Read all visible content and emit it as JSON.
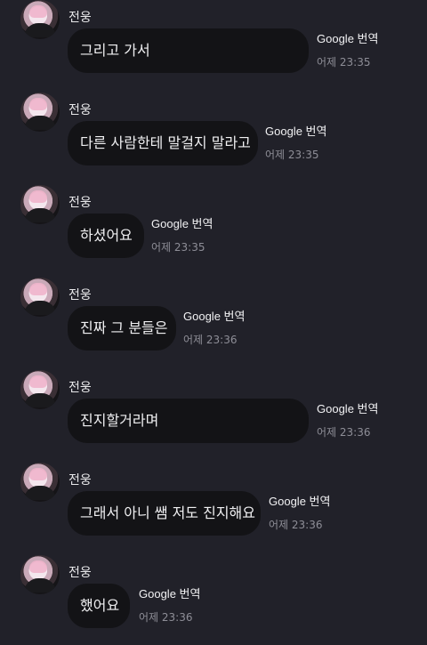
{
  "messages": [
    {
      "sender": "전웅",
      "text": "그리고 가서",
      "translate_label": "Google 번역",
      "timestamp": "어제 23:35"
    },
    {
      "sender": "전웅",
      "text": "다른 사람한테 말걸지 말라고",
      "translate_label": "Google 번역",
      "timestamp": "어제 23:35"
    },
    {
      "sender": "전웅",
      "text": "하셨어요",
      "translate_label": "Google 번역",
      "timestamp": "어제 23:35"
    },
    {
      "sender": "전웅",
      "text": "진짜 그 분들은",
      "translate_label": "Google 번역",
      "timestamp": "어제 23:36"
    },
    {
      "sender": "전웅",
      "text": "진지할거라며",
      "translate_label": "Google 번역",
      "timestamp": "어제 23:36"
    },
    {
      "sender": "전웅",
      "text": "그래서 아니 쌤 저도 진지해요",
      "translate_label": "Google 번역",
      "timestamp": "어제 23:36"
    },
    {
      "sender": "전웅",
      "text": "했어요",
      "translate_label": "Google 번역",
      "timestamp": "어제 23:36"
    }
  ],
  "colors": {
    "background": "#212129",
    "bubble": "#131316",
    "text": "#f0f0f2",
    "muted": "#8e8e97"
  }
}
